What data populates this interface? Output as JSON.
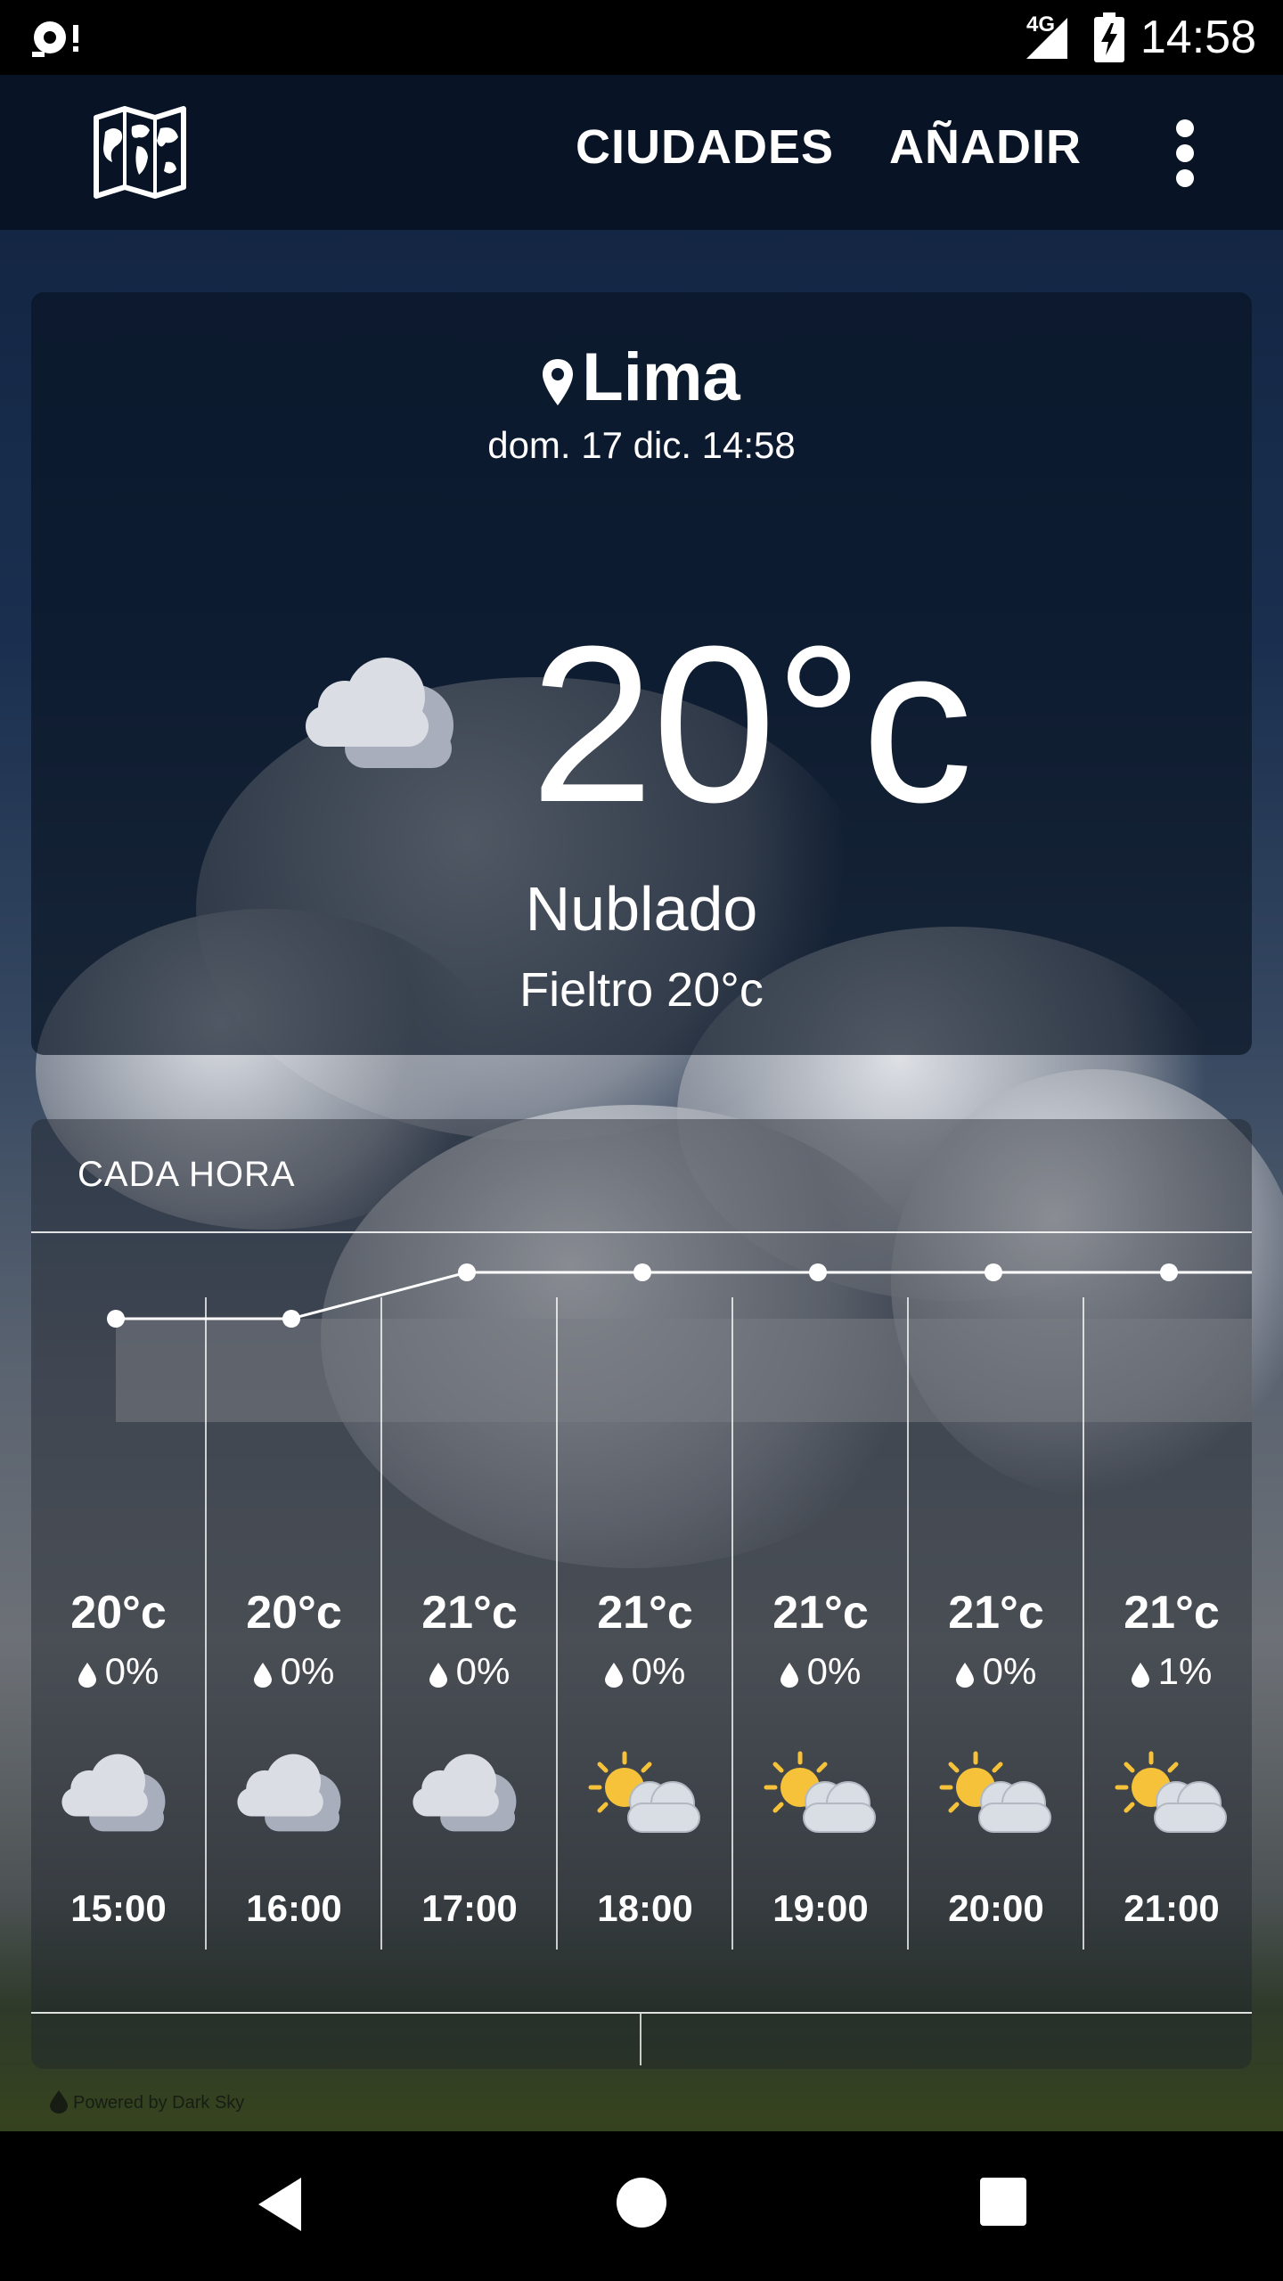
{
  "status_bar": {
    "network": "4G",
    "time": "14:58"
  },
  "app_bar": {
    "cities_label": "CIUDADES",
    "add_label": "AÑADIR"
  },
  "current": {
    "location": "Lima",
    "datetime": "dom. 17 dic. 14:58",
    "temperature": "20°c",
    "condition": "Nublado",
    "feels_like": "Fieltro 20°c",
    "icon": "cloudy-icon"
  },
  "hourly": {
    "title": "CADA HORA",
    "items": [
      {
        "temp": "20°c",
        "precip": "0%",
        "time": "15:00",
        "icon": "cloudy-icon"
      },
      {
        "temp": "20°c",
        "precip": "0%",
        "time": "16:00",
        "icon": "cloudy-icon"
      },
      {
        "temp": "21°c",
        "precip": "0%",
        "time": "17:00",
        "icon": "cloudy-icon"
      },
      {
        "temp": "21°c",
        "precip": "0%",
        "time": "18:00",
        "icon": "partly-cloudy-icon"
      },
      {
        "temp": "21°c",
        "precip": "0%",
        "time": "19:00",
        "icon": "partly-cloudy-icon"
      },
      {
        "temp": "21°c",
        "precip": "0%",
        "time": "20:00",
        "icon": "partly-cloudy-icon"
      },
      {
        "temp": "21°c",
        "precip": "1%",
        "time": "21:00",
        "icon": "partly-cloudy-icon"
      }
    ]
  },
  "chart_data": {
    "type": "line",
    "x": [
      "15:00",
      "16:00",
      "17:00",
      "18:00",
      "19:00",
      "20:00",
      "21:00"
    ],
    "series": [
      {
        "values": [
          20,
          20,
          21,
          21,
          21,
          21,
          21
        ]
      }
    ]
  },
  "footer": {
    "powered_by": "Powered by Dark Sky"
  },
  "colors": {
    "status_bar": "#000000",
    "app_bar": "#0a1426",
    "sun": "#f5c23a",
    "cloud": "#d9dde4"
  }
}
